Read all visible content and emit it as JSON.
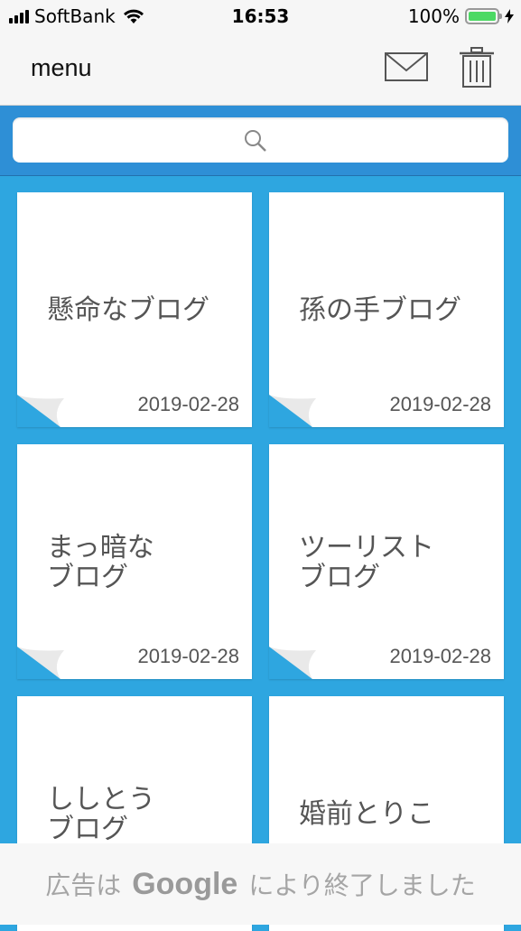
{
  "status_bar": {
    "carrier": "SoftBank",
    "time": "16:53",
    "battery": "100%"
  },
  "nav": {
    "menu_label": "menu",
    "icons": [
      "mail-icon",
      "trash-icon"
    ]
  },
  "search": {
    "placeholder": ""
  },
  "notes": [
    {
      "title": "懸命なブログ",
      "date": "2019-02-28"
    },
    {
      "title": "孫の手ブログ",
      "date": "2019-02-28"
    },
    {
      "title": "まっ暗な\nブログ",
      "date": "2019-02-28"
    },
    {
      "title": "ツーリスト\nブログ",
      "date": "2019-02-28"
    },
    {
      "title": "ししとう\nブログ",
      "date": ""
    },
    {
      "title": "婚前とりこ",
      "date": ""
    }
  ],
  "ad_banner": {
    "prefix": "広告は",
    "brand": "Google",
    "suffix": "により終了しました"
  },
  "colors": {
    "background_blue": "#2ea6e0",
    "search_bar_blue": "#2e8fd6",
    "bar_gray": "#f6f6f6",
    "battery_green": "#4cd964"
  }
}
